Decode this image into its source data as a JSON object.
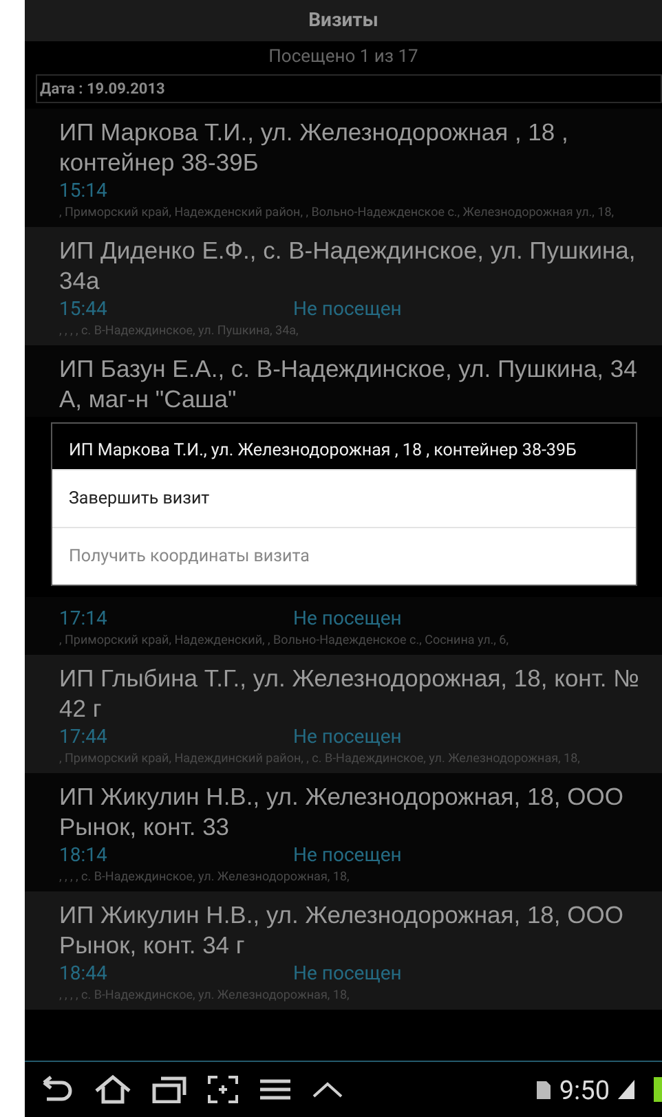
{
  "header": {
    "title": "Визиты"
  },
  "summary": "Посещено 1 из 17",
  "date_filter": "Дата : 19.09.2013",
  "visits": [
    {
      "title": "ИП Маркова Т.И., ул. Железнодорожная , 18 , контейнер 38-39Б",
      "time": "15:14",
      "address": ", Приморский край,  Надежденский район, ,  Вольно-Надежденское с.,  Железнодорожная ул.,  18,"
    },
    {
      "title": "ИП Диденко Е.Ф., с. В-Надеждинское, ул. Пушкина, 34а",
      "time": "15:44",
      "status": "Не посещен",
      "address": ", , , ,  с. В-Надеждинское,  ул. Пушкина,  34а,"
    },
    {
      "title": "ИП Базун Е.А., с. В-Надеждинское, ул. Пушкина, 34 А, маг-н \"Саша\""
    },
    {
      "time": "17:14",
      "status": "Не посещен",
      "address": ", Приморский край,  Надежденский, ,  Вольно-Надежденское с.,  Соснина ул.,  6,"
    },
    {
      "title": "ИП Глыбина Т.Г., ул. Железнодорожная, 18, конт. № 42 г",
      "time": "17:44",
      "status": "Не посещен",
      "address": ", Приморский край,  Надеждинский район, ,  с. В-Надеждинское,  ул. Железнодорожная,  18,"
    },
    {
      "title": "ИП Жикулин Н.В., ул. Железнодорожная, 18, ООО Рынок, конт. 33",
      "time": "18:14",
      "status": "Не посещен",
      "address": ", , , ,  с. В-Надеждинское,  ул. Железнодорожная,  18,"
    },
    {
      "title": "ИП Жикулин Н.В., ул. Железнодорожная, 18, ООО Рынок, конт. 34 г",
      "time": "18:44",
      "status": "Не посещен",
      "address": ", , , ,  с. В-Надеждинское,  ул. Железнодорожная,  18,"
    }
  ],
  "context_menu": {
    "title": "ИП Маркова Т.И., ул. Железнодорожная , 18 , контейнер 38-39Б",
    "items": [
      {
        "label": "Завершить визит",
        "disabled": false
      },
      {
        "label": "Получить координаты визита",
        "disabled": true
      }
    ]
  },
  "status_bar": {
    "time": "9:50"
  }
}
